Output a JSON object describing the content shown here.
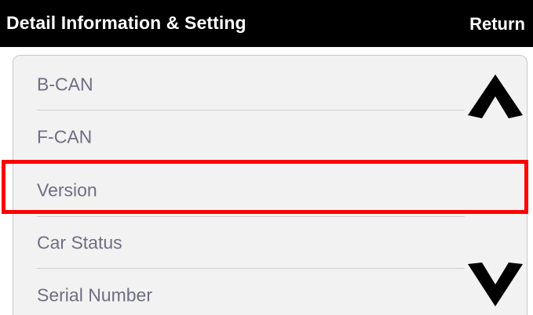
{
  "header": {
    "title": "Detail Information & Setting",
    "return_label": "Return"
  },
  "menu": {
    "items": [
      {
        "label": "B-CAN"
      },
      {
        "label": "F-CAN"
      },
      {
        "label": "Version"
      },
      {
        "label": "Car Status"
      },
      {
        "label": "Serial Number"
      }
    ]
  },
  "scroll": {
    "up_icon": "scroll-up-arrow-icon",
    "down_icon": "scroll-down-arrow-icon"
  },
  "highlighted_item": "Version",
  "colors": {
    "header_bg": "#000000",
    "header_text": "#ffffff",
    "panel_bg": "#f2f2f2",
    "item_text": "#6f6e82",
    "highlight": "#ff0000"
  }
}
